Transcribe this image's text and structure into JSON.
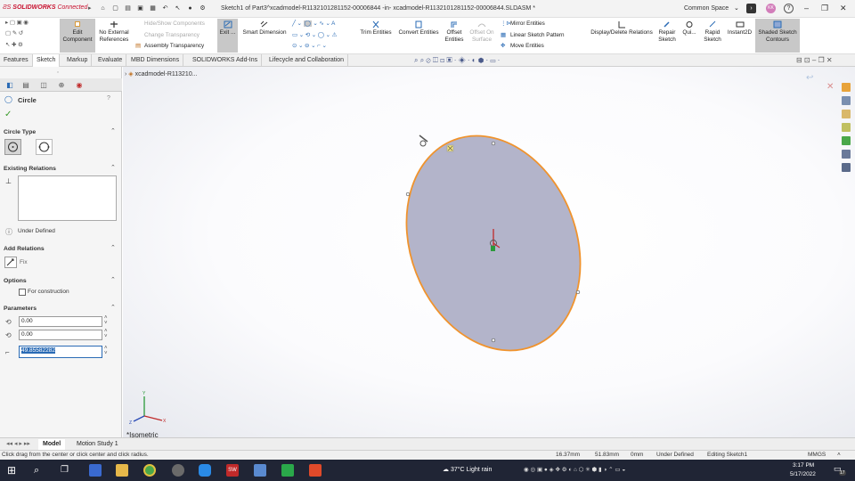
{
  "title_bar": {
    "logo_brand": "SOLIDWORKS",
    "logo_suffix": "Connected",
    "window_title": "Sketch1 of Part3^xcadmodel-R1132101281152-00006844 -in- xcadmodel-R1132101281152-00006844.SLDASM *",
    "common_space": "Common Space",
    "avatar_initials": "KK"
  },
  "ribbon": {
    "edit_component": "Edit Component",
    "no_external_references": "No External References",
    "hide_show_components": "Hide/Show Components",
    "change_transparency": "Change Transparency",
    "assembly_transparency": "Assembly Transparency",
    "exit_sketch": "Exit ...",
    "smart_dimension": "Smart Dimension",
    "trim_entities": "Trim Entities",
    "convert_entities": "Convert Entities",
    "offset_entities": "Offset Entities",
    "offset_on_surface": "Offset On Surface",
    "mirror_entities": "Mirror Entities",
    "linear_sketch_pattern": "Linear Sketch Pattern",
    "move_entities": "Move Entities",
    "display_delete_relations": "Display/Delete Relations",
    "repair_sketch": "Repair Sketch",
    "quick_snaps": "Qui...",
    "rapid_sketch": "Rapid Sketch",
    "instant2d": "Instant2D",
    "shaded_sketch_contours": "Shaded Sketch Contours"
  },
  "tabs": [
    "Features",
    "Sketch",
    "Markup",
    "Evaluate",
    "MBD Dimensions",
    "SOLIDWORKS Add-Ins",
    "Lifecycle and Collaboration"
  ],
  "active_tab": "Sketch",
  "property_manager": {
    "title": "Circle",
    "circle_type_label": "Circle Type",
    "existing_relations_label": "Existing Relations",
    "status": "Under Defined",
    "add_relations_label": "Add Relations",
    "fix_label": "Fix",
    "options_label": "Options",
    "for_construction": "For construction",
    "parameters_label": "Parameters",
    "center_x": "0.00",
    "center_y": "0.00",
    "radius": "49.85582282"
  },
  "tree_item": "xcadmodel-R113210...",
  "view_label": "*Isometric",
  "bottom_tabs": [
    "Model",
    "Motion Study 1"
  ],
  "status_bar": {
    "hint": "Click drag from the center or click center and click radius.",
    "x_coord": "16.37mm",
    "y_coord": "51.83mm",
    "z_coord": "0mm",
    "definition": "Under Defined",
    "editing": "Editing Sketch1",
    "units": "MMGS"
  },
  "taskbar": {
    "weather": "37°C  Light rain",
    "time": "3:17 PM",
    "date": "5/17/2022",
    "notification_count": "17"
  },
  "colors": {
    "circle_fill": "#b3b4ca",
    "circle_stroke": "#f0932d",
    "accent_red": "#c8102e"
  }
}
